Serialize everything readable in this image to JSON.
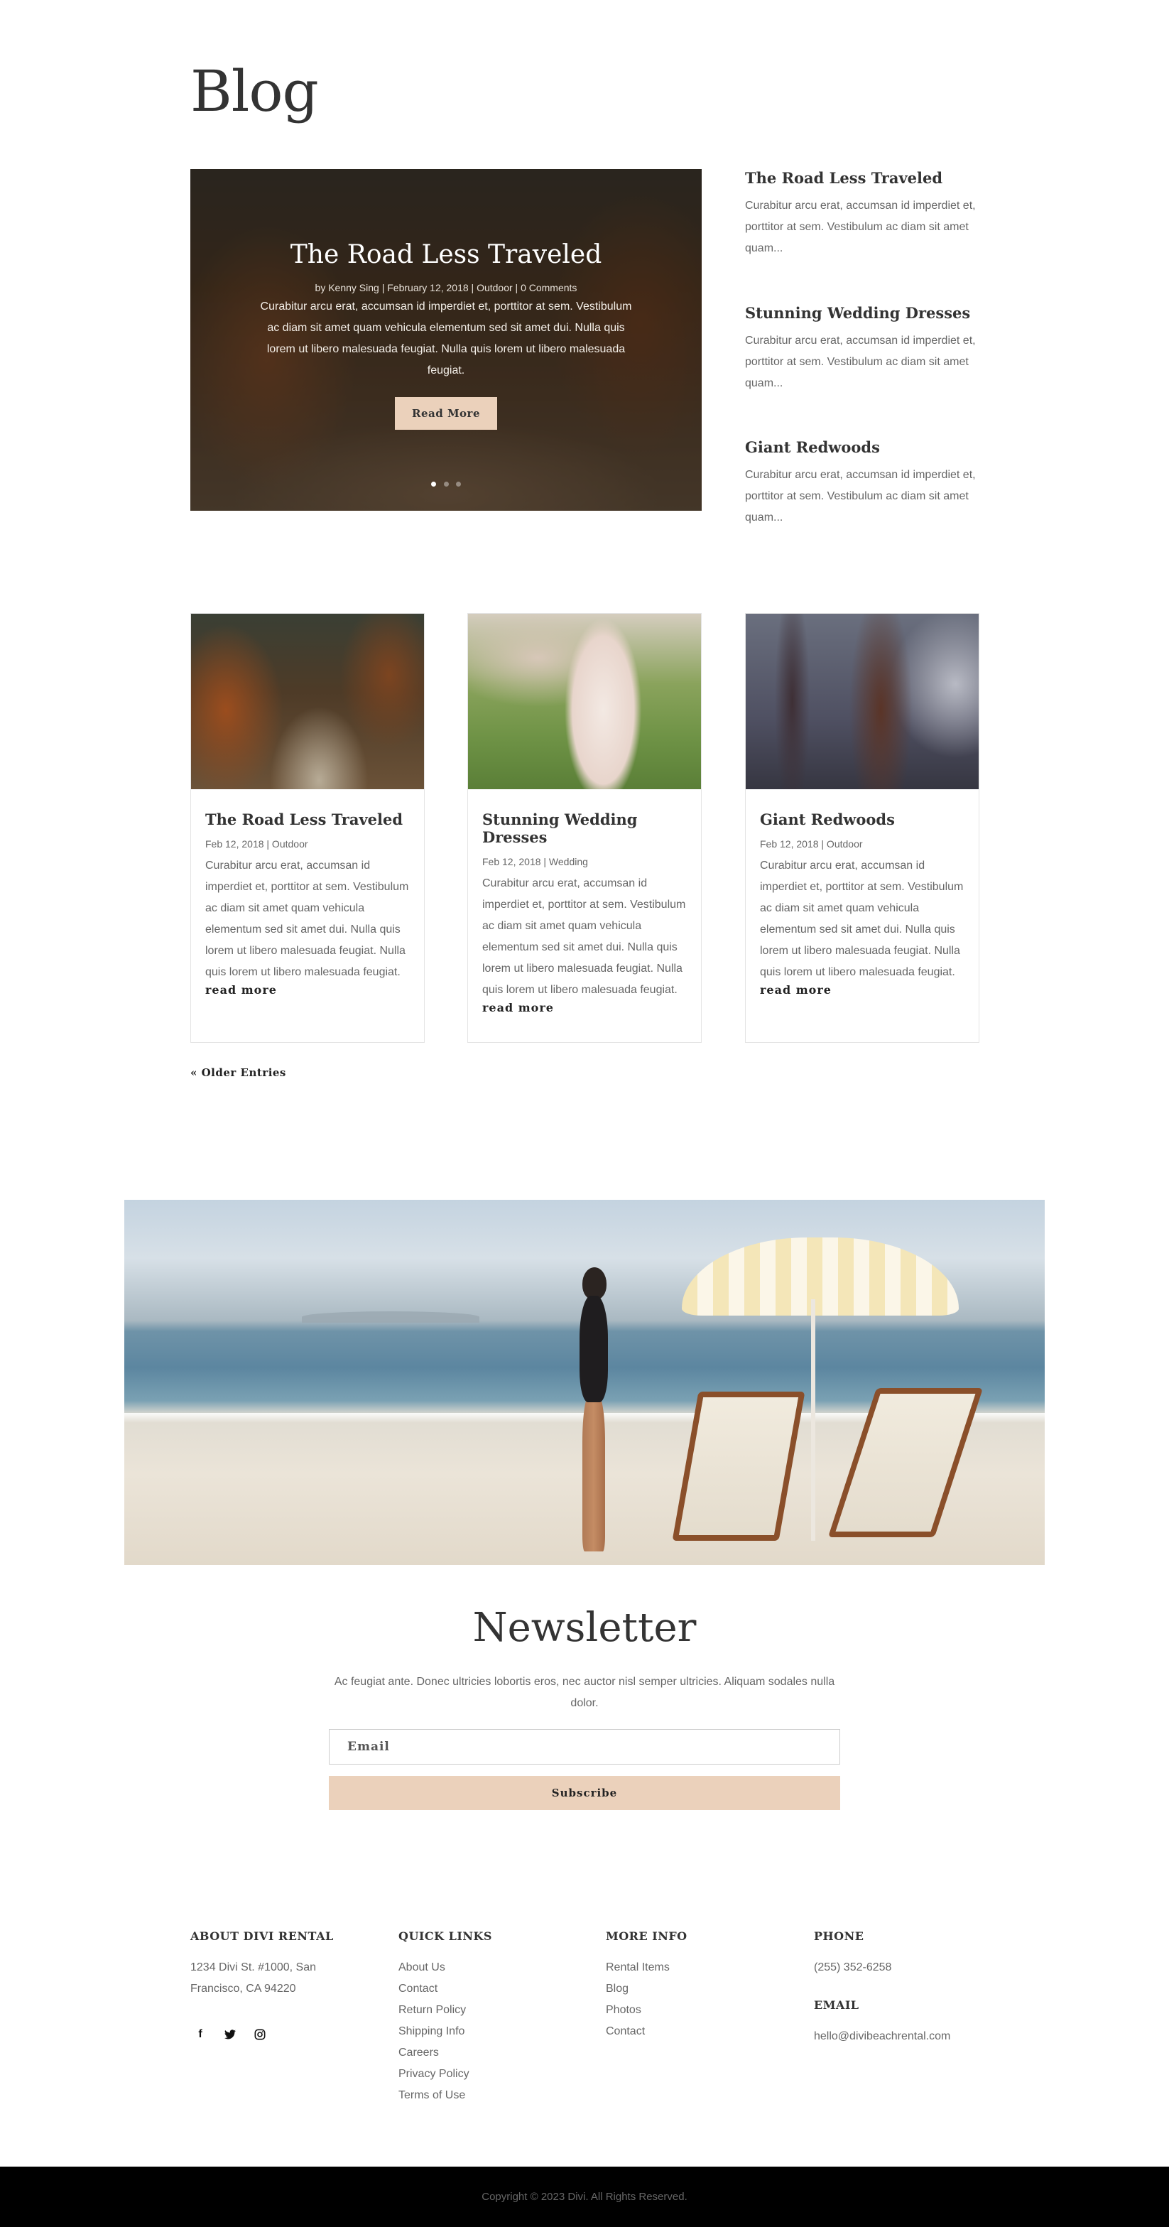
{
  "page": {
    "title": "Blog"
  },
  "slider": {
    "title": "The Road Less Traveled",
    "meta": "by Kenny Sing | February 12, 2018 | Outdoor | 0 Comments",
    "text": "Curabitur arcu erat, accumsan id imperdiet et, porttitor at sem. Vestibulum ac diam sit amet quam vehicula elementum sed sit amet dui. Nulla quis lorem ut libero malesuada feugiat. Nulla quis lorem ut libero malesuada feugiat.",
    "button": "Read More"
  },
  "side_posts": [
    {
      "title": "The Road Less Traveled",
      "excerpt": "Curabitur arcu erat, accumsan id imperdiet et, porttitor at sem. Vestibulum ac diam sit amet quam..."
    },
    {
      "title": "Stunning Wedding Dresses",
      "excerpt": "Curabitur arcu erat, accumsan id imperdiet et, porttitor at sem. Vestibulum ac diam sit amet quam..."
    },
    {
      "title": "Giant Redwoods",
      "excerpt": "Curabitur arcu erat, accumsan id imperdiet et, porttitor at sem. Vestibulum ac diam sit amet quam..."
    }
  ],
  "cards": [
    {
      "title": "The Road Less Traveled",
      "meta": "Feb 12, 2018 | Outdoor",
      "text": "Curabitur arcu erat, accumsan id imperdiet et, porttitor at sem. Vestibulum ac diam sit amet quam vehicula elementum sed sit amet dui. Nulla quis lorem ut libero malesuada feugiat. Nulla quis lorem ut libero malesuada feugiat.",
      "more": "read more"
    },
    {
      "title": "Stunning Wedding Dresses",
      "meta": "Feb 12, 2018 | Wedding",
      "text": "Curabitur arcu erat, accumsan id imperdiet et, porttitor at sem. Vestibulum ac diam sit amet quam vehicula elementum sed sit amet dui. Nulla quis lorem ut libero malesuada feugiat. Nulla quis lorem ut libero malesuada feugiat.",
      "more": "read more"
    },
    {
      "title": "Giant Redwoods",
      "meta": "Feb 12, 2018 | Outdoor",
      "text": "Curabitur arcu erat, accumsan id imperdiet et, porttitor at sem. Vestibulum ac diam sit amet quam vehicula elementum sed sit amet dui. Nulla quis lorem ut libero malesuada feugiat. Nulla quis lorem ut libero malesuada feugiat.",
      "more": "read more"
    }
  ],
  "pagination": {
    "older": "« Older Entries"
  },
  "newsletter": {
    "title": "Newsletter",
    "text": "Ac feugiat ante. Donec ultricies lobortis eros, nec auctor nisl semper ultricies. Aliquam sodales nulla dolor.",
    "email_placeholder": "Email",
    "button": "Subscribe"
  },
  "footer": {
    "about": {
      "heading": "ABOUT DIVI RENTAL",
      "address1": "1234 Divi St. #1000, San",
      "address2": "Francisco, CA 94220"
    },
    "social": {
      "facebook": "f",
      "twitter": "🐦",
      "instagram": "◎"
    },
    "quick_links": {
      "heading": "QUICK LINKS",
      "items": [
        "About Us",
        "Contact",
        "Return Policy",
        "Shipping Info",
        "Careers",
        "Privacy Policy",
        "Terms of Use"
      ]
    },
    "more_info": {
      "heading": "MORE INFO",
      "items": [
        "Rental Items",
        "Blog",
        "Photos",
        "Contact"
      ]
    },
    "phone": {
      "heading": "PHONE",
      "value": "(255) 352-6258"
    },
    "email": {
      "heading": "EMAIL",
      "value": "hello@divibeachrental.com"
    },
    "copyright": "Copyright © 2023 Divi. All Rights Reserved."
  },
  "colors": {
    "accent": "#ebd1bb",
    "text": "#666666",
    "heading": "#333333",
    "footer_bar": "#000000"
  }
}
